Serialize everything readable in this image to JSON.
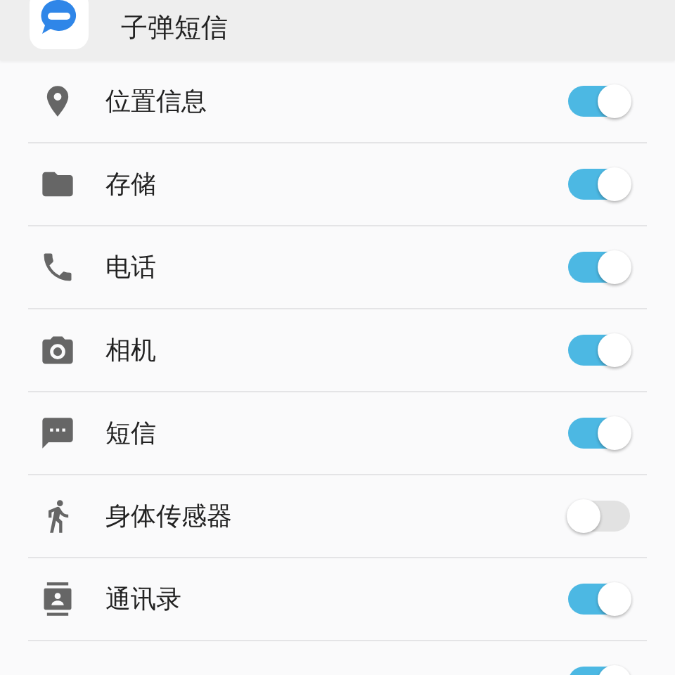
{
  "header": {
    "title": "子弹短信"
  },
  "permissions": [
    {
      "label": "位置信息",
      "on": true
    },
    {
      "label": "存储",
      "on": true
    },
    {
      "label": "电话",
      "on": true
    },
    {
      "label": "相机",
      "on": true
    },
    {
      "label": "短信",
      "on": true
    },
    {
      "label": "身体传感器",
      "on": false
    },
    {
      "label": "通讯录",
      "on": true
    },
    {
      "on": true
    }
  ]
}
